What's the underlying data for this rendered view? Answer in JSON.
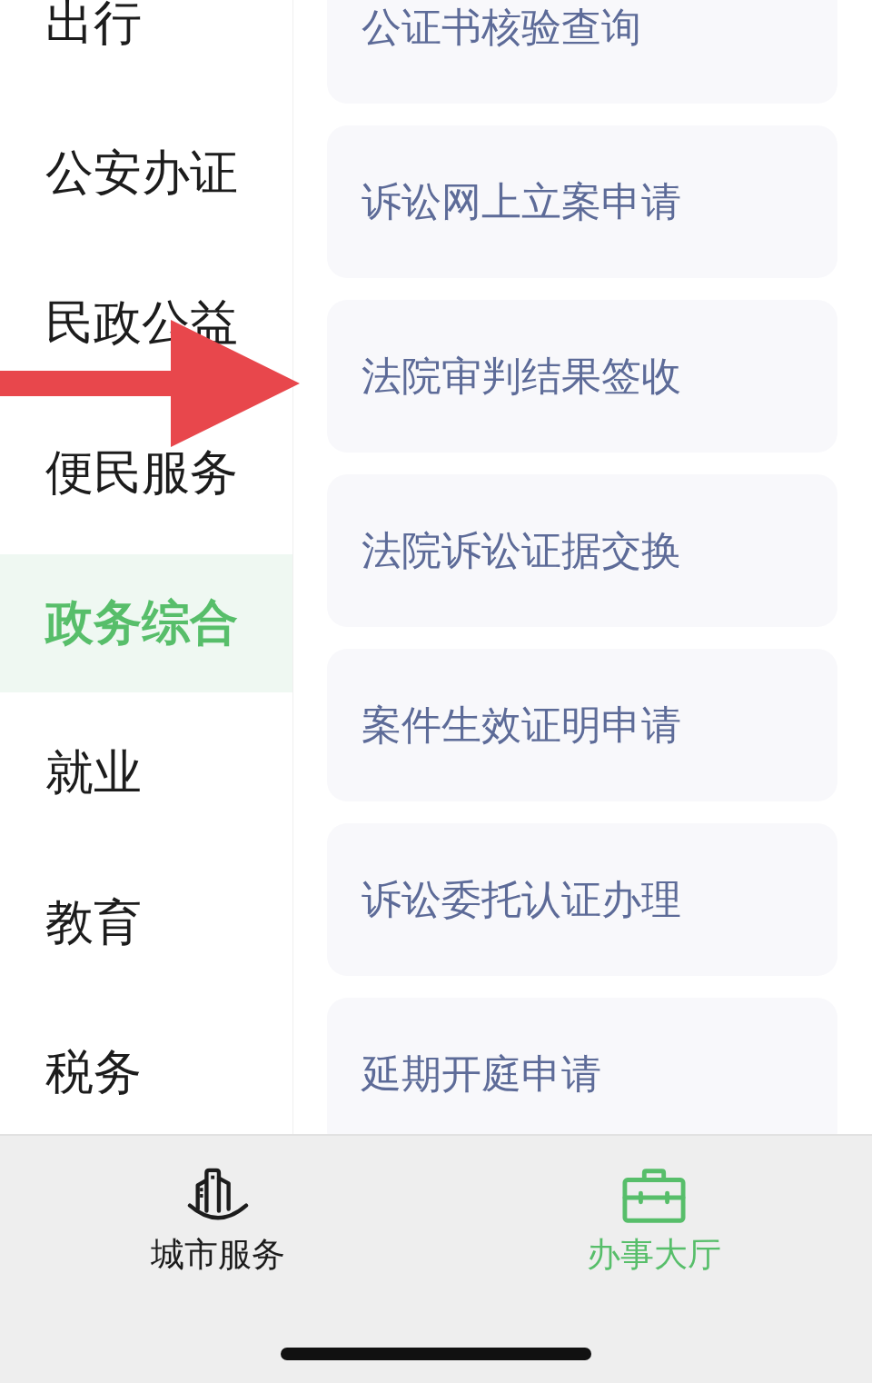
{
  "sidebar": {
    "items": [
      {
        "label": "出行",
        "selected": false
      },
      {
        "label": "公安办证",
        "selected": false
      },
      {
        "label": "民政公益",
        "selected": false
      },
      {
        "label": "便民服务",
        "selected": false
      },
      {
        "label": "政务综合",
        "selected": true
      },
      {
        "label": "就业",
        "selected": false
      },
      {
        "label": "教育",
        "selected": false
      },
      {
        "label": "税务",
        "selected": false
      }
    ]
  },
  "services": {
    "items": [
      "公证书核验查询",
      "诉讼网上立案申请",
      "法院审判结果签收",
      "法院诉讼证据交换",
      "案件生效证明申请",
      "诉讼委托认证办理",
      "延期开庭申请"
    ]
  },
  "tab_bar": {
    "tabs": [
      {
        "label": "城市服务",
        "selected": false
      },
      {
        "label": "办事大厅",
        "selected": true
      }
    ]
  }
}
